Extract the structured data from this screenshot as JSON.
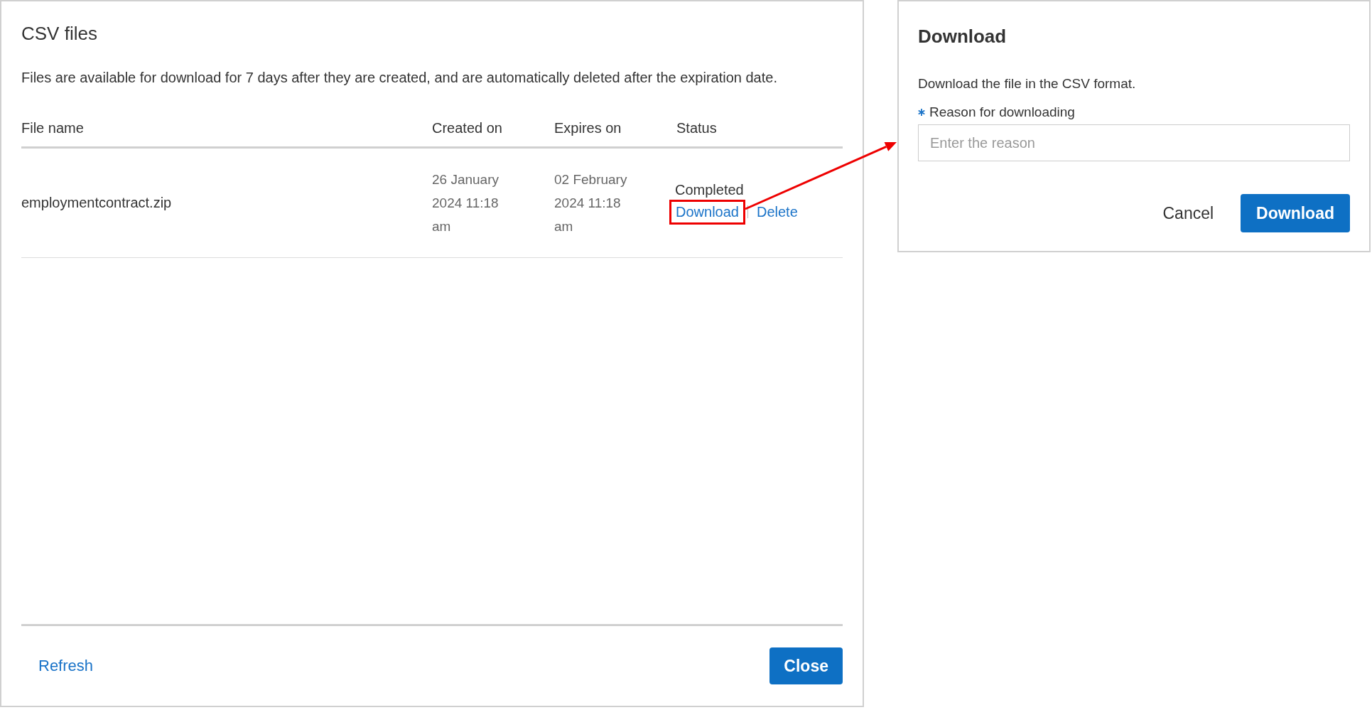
{
  "files_panel": {
    "title": "CSV files",
    "description": "Files are available for download for 7 days after they are created, and are automatically deleted after the expiration date.",
    "table": {
      "columns": [
        "File name",
        "Created on",
        "Expires on",
        "Status"
      ],
      "rows": [
        {
          "file_name": "employmentcontract.zip",
          "created_on": "26 January 2024 11:18 am",
          "expires_on": "02 February 2024 11:18 am",
          "status": "Completed",
          "actions": [
            {
              "label": "Download",
              "highlighted": true
            },
            {
              "label": "Delete",
              "highlighted": false
            }
          ]
        }
      ]
    },
    "footer": {
      "refresh": "Refresh",
      "close": "Close"
    }
  },
  "download_dialog": {
    "title": "Download",
    "description": "Download the file in the CSV format.",
    "field": {
      "label": "Reason for downloading",
      "required": true,
      "placeholder": "Enter the reason"
    },
    "buttons": {
      "cancel": "Cancel",
      "download": "Download"
    }
  }
}
